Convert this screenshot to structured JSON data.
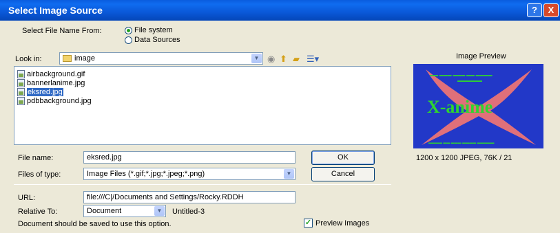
{
  "window": {
    "title": "Select Image Source",
    "help_label": "?",
    "close_label": "X"
  },
  "select_from": {
    "label": "Select File Name From:",
    "options": [
      {
        "label": "File system",
        "selected": true
      },
      {
        "label": "Data Sources",
        "selected": false
      }
    ]
  },
  "look_in": {
    "label": "Look in:",
    "value": "image"
  },
  "files": [
    {
      "name": "airbackground.gif",
      "selected": false
    },
    {
      "name": "bannerlanime.jpg",
      "selected": false
    },
    {
      "name": "eksred.jpg",
      "selected": true
    },
    {
      "name": "pdbbackground.jpg",
      "selected": false
    }
  ],
  "file_name": {
    "label": "File name:",
    "value": "eksred.jpg"
  },
  "files_of_type": {
    "label": "Files of type:",
    "value": "Image Files (*.gif;*.jpg;*.jpeg;*.png)"
  },
  "buttons": {
    "ok": "OK",
    "cancel": "Cancel"
  },
  "url": {
    "label": "URL:",
    "value": "file:///C|/Documents and Settings/Rocky.RDDH"
  },
  "relative_to": {
    "label": "Relative To:",
    "value": "Document",
    "doc_name": "Untitled-3"
  },
  "note": "Document should be saved to use this option.",
  "preview_images": {
    "label": "Preview Images",
    "checked": true
  },
  "preview": {
    "heading": "Image Preview",
    "logo_text": "X-anime",
    "info": "1200 x 1200 JPEG, 76K / 21",
    "colors": {
      "background": "#2238c8",
      "x_shape": "#e0707a",
      "text": "#2fd42f"
    }
  }
}
